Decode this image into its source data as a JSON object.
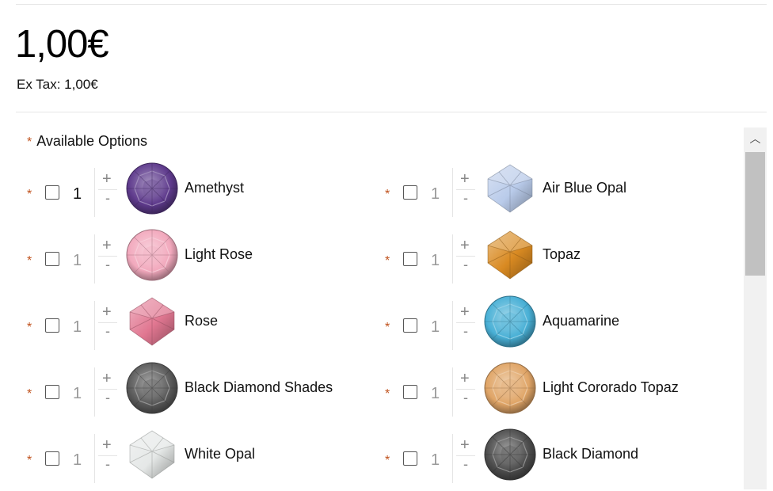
{
  "price": {
    "main": "1,00€",
    "ex_tax": "Ex Tax: 1,00€"
  },
  "options_heading": "Available Options",
  "required_marker": "*",
  "stepper": {
    "plus": "+",
    "minus": "-"
  },
  "options": [
    {
      "name": "Amethyst",
      "qty": "1",
      "checked": false,
      "gem_color": "#5e3a8c",
      "gem_shape": "round"
    },
    {
      "name": "Air Blue Opal",
      "qty": "1",
      "checked": false,
      "gem_color": "#b9cbea",
      "gem_shape": "bicone"
    },
    {
      "name": "Light Rose",
      "qty": "1",
      "checked": false,
      "gem_color": "#f2a9bd",
      "gem_shape": "round"
    },
    {
      "name": "Topaz",
      "qty": "1",
      "checked": false,
      "gem_color": "#d98a22",
      "gem_shape": "bicone"
    },
    {
      "name": "Rose",
      "qty": "1",
      "checked": false,
      "gem_color": "#e17791",
      "gem_shape": "bicone"
    },
    {
      "name": "Aquamarine",
      "qty": "1",
      "checked": false,
      "gem_color": "#49b0d6",
      "gem_shape": "round"
    },
    {
      "name": "Black Diamond Shades",
      "qty": "1",
      "checked": false,
      "gem_color": "#5a5a5a",
      "gem_shape": "round"
    },
    {
      "name": "Light Cororado Topaz",
      "qty": "1",
      "checked": false,
      "gem_color": "#e0a567",
      "gem_shape": "round"
    },
    {
      "name": "White Opal",
      "qty": "1",
      "checked": false,
      "gem_color": "#e5e8e7",
      "gem_shape": "bicone"
    },
    {
      "name": "Black Diamond",
      "qty": "1",
      "checked": false,
      "gem_color": "#4d4d4d",
      "gem_shape": "round"
    }
  ],
  "scrollbar": {
    "up_icon": "chevron-up-icon",
    "position": 0
  }
}
